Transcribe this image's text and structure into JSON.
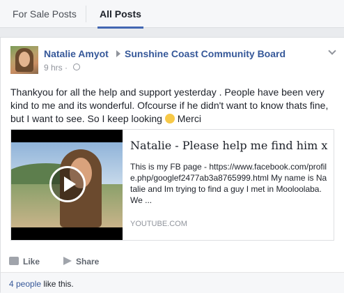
{
  "tabs": [
    {
      "label": "For Sale Posts",
      "active": false
    },
    {
      "label": "All Posts",
      "active": true
    }
  ],
  "post": {
    "author": "Natalie Amyot",
    "group": "Sunshine Coast Community Board",
    "time": "9 hrs",
    "time_separator": "·",
    "text_before_emoji": "Thankyou for all the help and support yesterday . People have been very kind to me and its wonderful. Ofcourse if he didn't want to know thats fine, but I want to see. So I keep looking",
    "text_after_emoji": "Merci",
    "emoji": "smile",
    "link": {
      "title": "Natalie - Please help me find him x",
      "description": "This is my FB page - https://www.facebook.com/profile.php/googlef2477ab3a8765999.html My name is Natalie and Im trying to find a guy I met in Mooloolaba. We ...",
      "source": "YOUTUBE.COM"
    },
    "actions": {
      "like": "Like",
      "share": "Share"
    },
    "likes": {
      "count": "4 people",
      "suffix": " like this."
    }
  },
  "colors": {
    "accent": "#4267b2",
    "link": "#365899",
    "muted": "#90949c",
    "background": "#e9ebee"
  }
}
